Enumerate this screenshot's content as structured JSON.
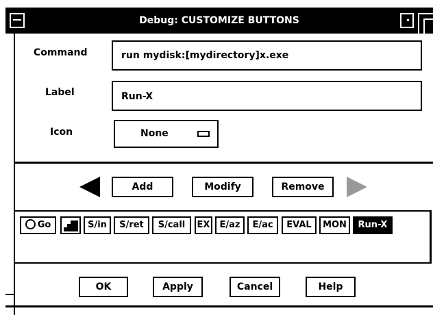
{
  "window": {
    "title": "Debug: CUSTOMIZE BUTTONS"
  },
  "form": {
    "command_label": "Command",
    "command_value": "run mydisk:[mydirectory]x.exe",
    "label_label": "Label",
    "label_value": "Run-X",
    "icon_label": "Icon",
    "icon_value": "None"
  },
  "actions": {
    "add": "Add",
    "modify": "Modify",
    "remove": "Remove"
  },
  "tray": {
    "buttons": [
      {
        "label": "Go",
        "icon": "circle-icon"
      },
      {
        "label": "",
        "icon": "step-icon"
      },
      {
        "label": "S/in"
      },
      {
        "label": "S/ret"
      },
      {
        "label": "S/call"
      },
      {
        "label": "EX"
      },
      {
        "label": "E/az"
      },
      {
        "label": "E/ac"
      },
      {
        "label": "EVAL"
      },
      {
        "label": "MON"
      },
      {
        "label": "Run-X",
        "selected": true
      }
    ]
  },
  "footer": {
    "ok": "OK",
    "apply": "Apply",
    "cancel": "Cancel",
    "help": "Help"
  }
}
